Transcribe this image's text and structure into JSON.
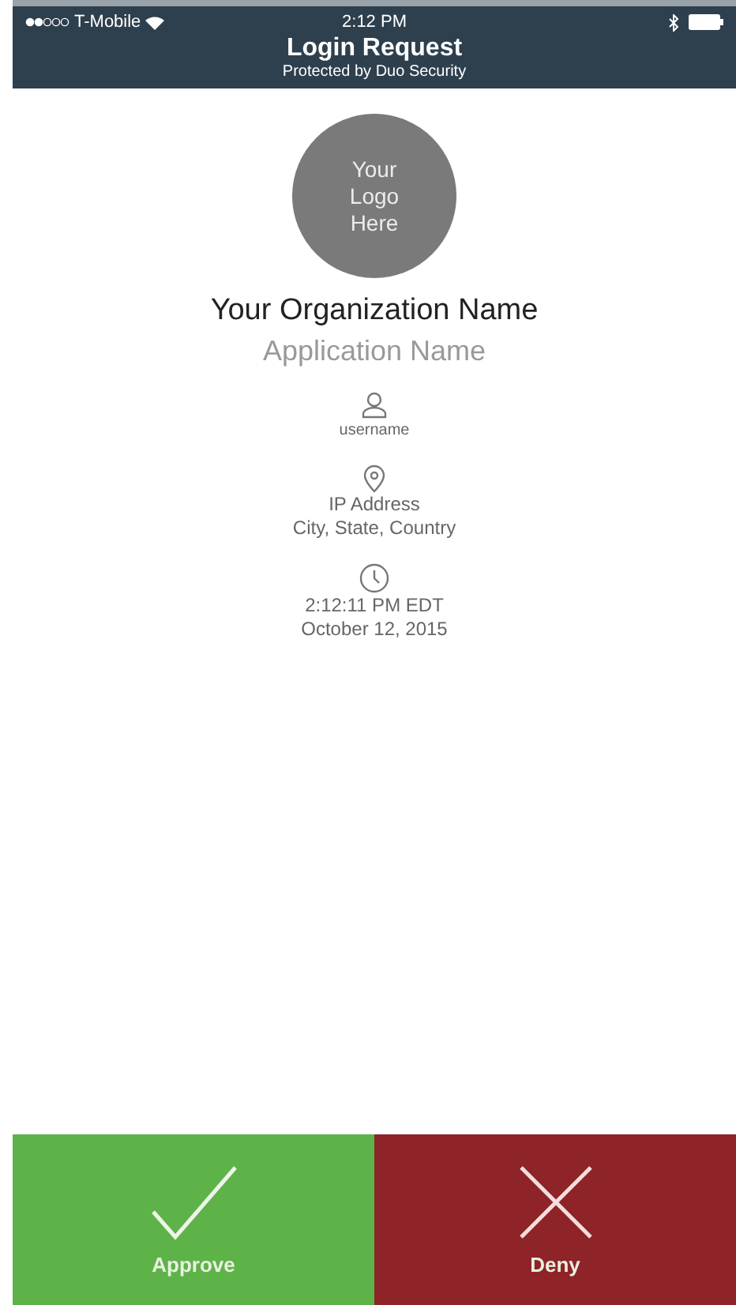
{
  "status_bar": {
    "carrier": "T-Mobile",
    "time": "2:12 PM"
  },
  "header": {
    "title": "Login Request",
    "subtitle": "Protected by Duo Security"
  },
  "logo": {
    "lines": [
      "Your",
      "Logo",
      "Here"
    ]
  },
  "organization": "Your Organization Name",
  "application": "Application Name",
  "details": [
    {
      "kind": "user",
      "lines": [
        "username"
      ]
    },
    {
      "kind": "location",
      "lines": [
        "IP Address",
        "City, State, Country"
      ]
    },
    {
      "kind": "time",
      "lines": [
        "2:12:11 PM EDT",
        "October 12, 2015"
      ]
    }
  ],
  "actions": [
    {
      "kind": "approve",
      "label": "Approve"
    },
    {
      "kind": "deny",
      "label": "Deny"
    }
  ]
}
